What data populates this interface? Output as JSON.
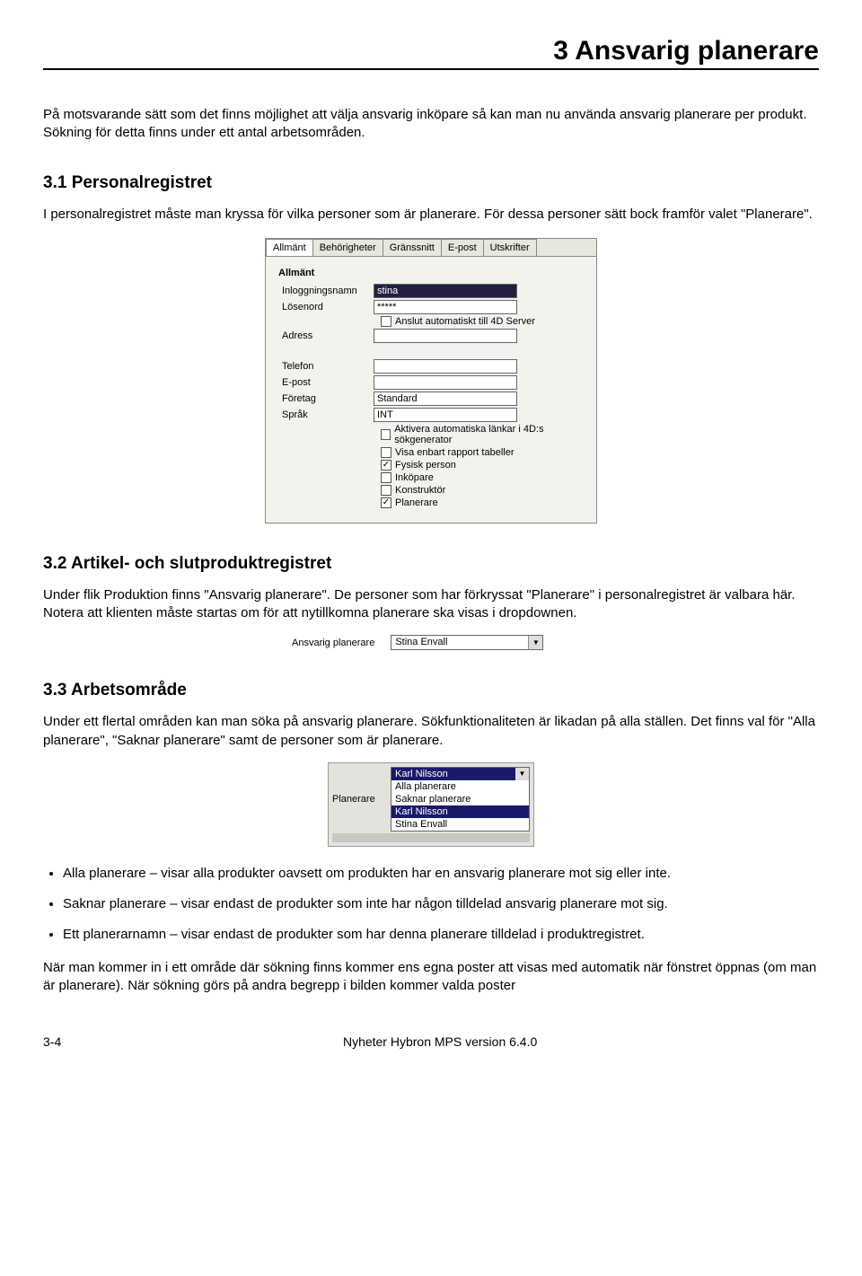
{
  "chapter_title": "3 Ansvarig planerare",
  "intro": "På motsvarande sätt som det finns möjlighet att välja ansvarig inköpare så kan man nu använda ansvarig planerare per produkt. Sökning för detta finns under ett antal arbetsområden.",
  "s31": {
    "title": "3.1  Personalregistret",
    "text": "I personalregistret måste man kryssa för vilka personer som är planerare. För dessa personer sätt bock framför valet \"Planerare\"."
  },
  "dialog": {
    "tabs": [
      "Allmänt",
      "Behörigheter",
      "Gränssnitt",
      "E-post",
      "Utskrifter"
    ],
    "active_tab": 0,
    "group": "Allmänt",
    "fields": {
      "inloggning_label": "Inloggningsnamn",
      "inloggning_value": "stina",
      "losenord_label": "Lösenord",
      "losenord_value": "*****",
      "adress_label": "Adress",
      "adress_value": "",
      "telefon_label": "Telefon",
      "telefon_value": "",
      "epost_label": "E-post",
      "epost_value": "",
      "foretag_label": "Företag",
      "foretag_value": "Standard",
      "sprak_label": "Språk",
      "sprak_value": "INT"
    },
    "checks": {
      "anslut": {
        "label": "Anslut automatiskt till 4D Server",
        "checked": false
      },
      "aktivera": {
        "label": "Aktivera automatiska länkar i 4D:s sökgenerator",
        "checked": false
      },
      "visa_rapport": {
        "label": "Visa enbart rapport tabeller",
        "checked": false
      },
      "fysisk": {
        "label": "Fysisk person",
        "checked": true
      },
      "inkopare": {
        "label": "Inköpare",
        "checked": false
      },
      "konstruktor": {
        "label": "Konstruktör",
        "checked": false
      },
      "planerare": {
        "label": "Planerare",
        "checked": true
      }
    }
  },
  "s32": {
    "title": "3.2  Artikel- och slutproduktregistret",
    "text": "Under flik Produktion finns \"Ansvarig planerare\". De personer som har förkryssat \"Planerare\" i personalregistret är valbara här. Notera att klienten måste startas om för att nytillkomna planerare ska visas i dropdownen."
  },
  "combo2": {
    "label": "Ansvarig planerare",
    "value": "Stina Envall"
  },
  "s33": {
    "title": "3.3  Arbetsområde",
    "text": "Under ett flertal områden kan man söka på ansvarig planerare. Sökfunktionaliteten är likadan på alla ställen. Det finns val för \"Alla planerare\", \"Saknar planerare\" samt de personer som är planerare."
  },
  "combo3": {
    "label": "Planerare",
    "selected": "Karl Nilsson",
    "items": [
      "Alla planerare",
      "Saknar planerare",
      "Karl Nilsson",
      "Stina Envall"
    ],
    "highlighted_index": 2
  },
  "bullets": [
    "Alla planerare – visar alla produkter oavsett om produkten har en ansvarig planerare mot sig eller inte.",
    "Saknar planerare – visar endast de produkter som inte har någon tilldelad ansvarig planerare mot sig.",
    "Ett planerarnamn – visar endast de produkter som har denna planerare tilldelad i produktregistret."
  ],
  "closing": "När man kommer in i ett område där sökning finns kommer ens egna poster att visas med automatik när fönstret öppnas (om man är planerare). När sökning görs på andra begrepp i bilden kommer valda poster",
  "footer": {
    "left": "3-4",
    "center": "Nyheter Hybron MPS version 6.4.0"
  }
}
